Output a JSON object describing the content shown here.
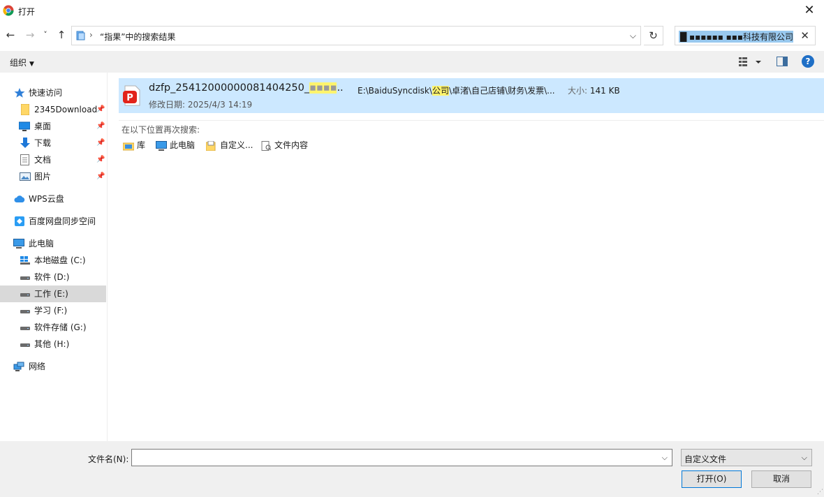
{
  "window": {
    "title": "打开",
    "close_label": "✕"
  },
  "nav": {
    "back": "←",
    "forward": "→",
    "recent": "˅",
    "up": "↑",
    "breadcrumb_sep": "›",
    "address": "“指果”中的搜索结果",
    "address_dropdown": "⌵",
    "refresh": "↻",
    "search_value": "█ ▪▪▪▪▪▪ ▪▪▪科技有限公司",
    "search_clear": "✕"
  },
  "toolbar": {
    "organize": "组织",
    "organize_caret": "▼",
    "help": "?"
  },
  "sidebar": {
    "items": [
      {
        "label": "快速访问",
        "icon": "star-icon"
      },
      {
        "label": "2345Download",
        "icon": "folder-icon",
        "pinned": true
      },
      {
        "label": "桌面",
        "icon": "desktop-icon",
        "pinned": true
      },
      {
        "label": "下载",
        "icon": "download-icon",
        "pinned": true
      },
      {
        "label": "文档",
        "icon": "document-icon",
        "pinned": true
      },
      {
        "label": "图片",
        "icon": "pictures-icon",
        "pinned": true
      },
      {
        "label": "WPS云盘",
        "icon": "cloud-icon"
      },
      {
        "label": "百度网盘同步空间",
        "icon": "baidu-icon"
      },
      {
        "label": "此电脑",
        "icon": "computer-icon"
      },
      {
        "label": "本地磁盘 (C:)",
        "icon": "windows-drive-icon"
      },
      {
        "label": "软件 (D:)",
        "icon": "drive-icon"
      },
      {
        "label": "工作 (E:)",
        "icon": "drive-icon",
        "selected": true
      },
      {
        "label": "学习 (F:)",
        "icon": "drive-icon"
      },
      {
        "label": "软件存储 (G:)",
        "icon": "drive-icon"
      },
      {
        "label": "其他 (H:)",
        "icon": "drive-icon"
      },
      {
        "label": "网络",
        "icon": "network-icon"
      }
    ],
    "pin_glyph": "📌"
  },
  "results": {
    "file": {
      "name_prefix": "dzfp_25412000000081404250_",
      "name_redacted": "▪▪▪▪",
      "name_suffix": "..",
      "modified_label": "修改日期:",
      "modified_value": "2025/4/3 14:19",
      "path_prefix": "E:\\BaiduSyncdisk\\",
      "path_highlight": "公司",
      "path_suffix": "\\卓渚\\自己店铺\\财务\\发票\\...",
      "size_label": "大小:",
      "size_value": "141 KB"
    },
    "search_again_label": "在以下位置再次搜索:",
    "locations": [
      {
        "label": "库",
        "icon": "library-icon"
      },
      {
        "label": "此电脑",
        "icon": "computer-icon"
      },
      {
        "label": "自定义...",
        "icon": "custom-folder-icon"
      },
      {
        "label": "文件内容",
        "icon": "file-content-icon"
      }
    ]
  },
  "bottom": {
    "filename_label": "文件名(N):",
    "filename_value": "",
    "filter_value": "自定义文件",
    "caret": "⌵",
    "open_button": "打开(O)",
    "cancel_button": "取消",
    "grip": "⋰"
  },
  "colors": {
    "selection": "#cce8ff",
    "highlight": "#fff46d",
    "accent": "#0078d7"
  }
}
